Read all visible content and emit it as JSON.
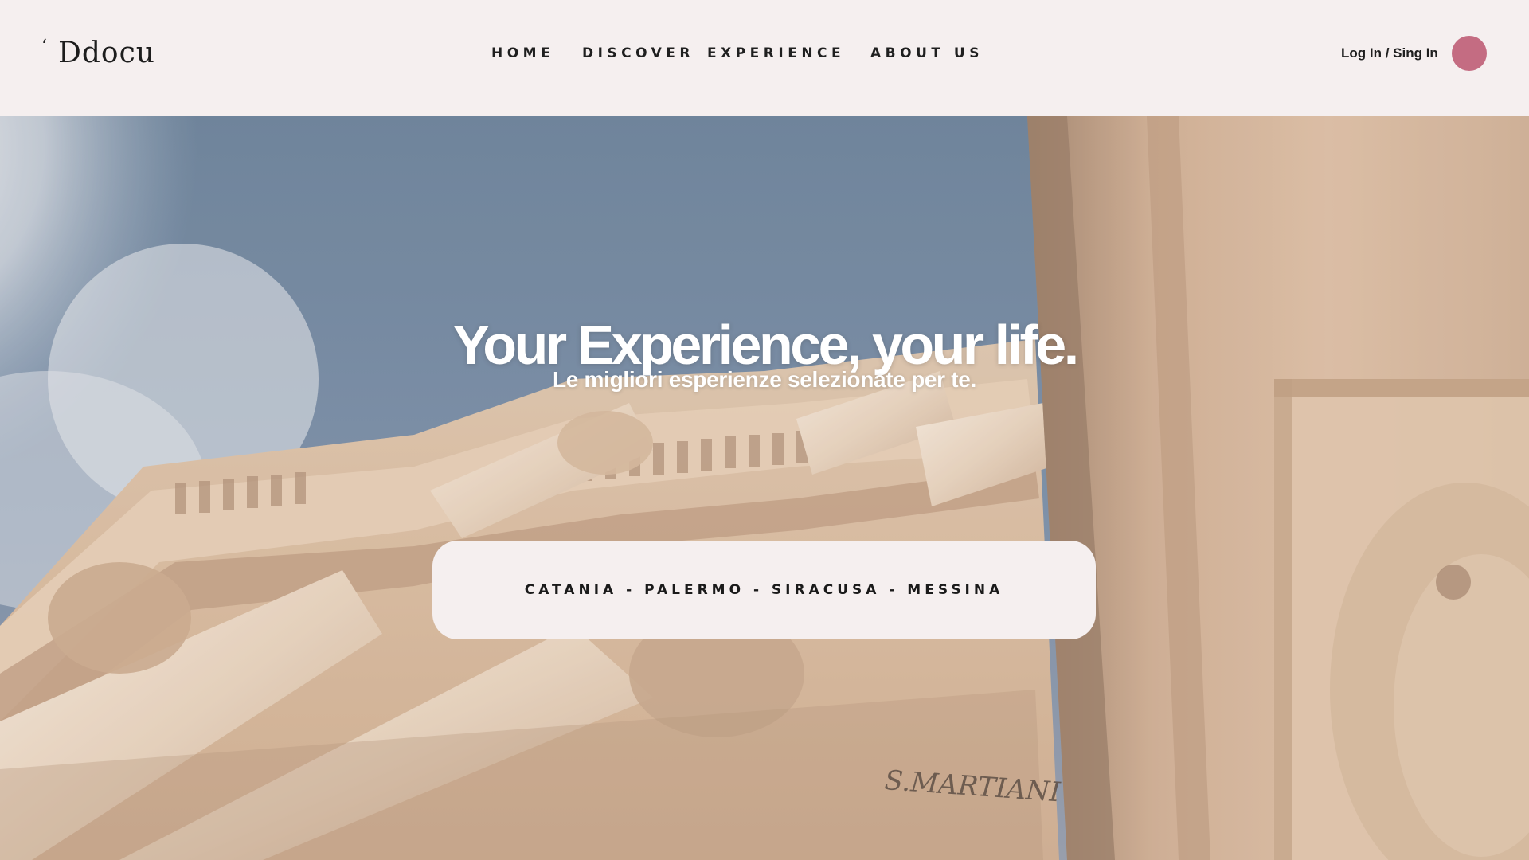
{
  "brand": {
    "logo_mark": "‘",
    "name": "Ddocu"
  },
  "nav": {
    "items": [
      {
        "label": "HOME"
      },
      {
        "label": "DISCOVER"
      },
      {
        "label": "EXPERIENCE"
      },
      {
        "label": "ABOUT US"
      }
    ]
  },
  "header": {
    "login_label": "Log In / Sing In",
    "avatar_color": "#c46c82"
  },
  "hero": {
    "title": "Your Experience, your life.",
    "subtitle": "Le migliori esperienze selezionate per te.",
    "cities": "CATANIA - PALERMO - SIRACUSA - MESSINA",
    "inscription": "S.MARTIANI"
  },
  "colors": {
    "header_bg": "#f5efef",
    "text_dark": "#1f1f1f",
    "sky": "#6a819c",
    "stone": "#d9bfa2"
  }
}
